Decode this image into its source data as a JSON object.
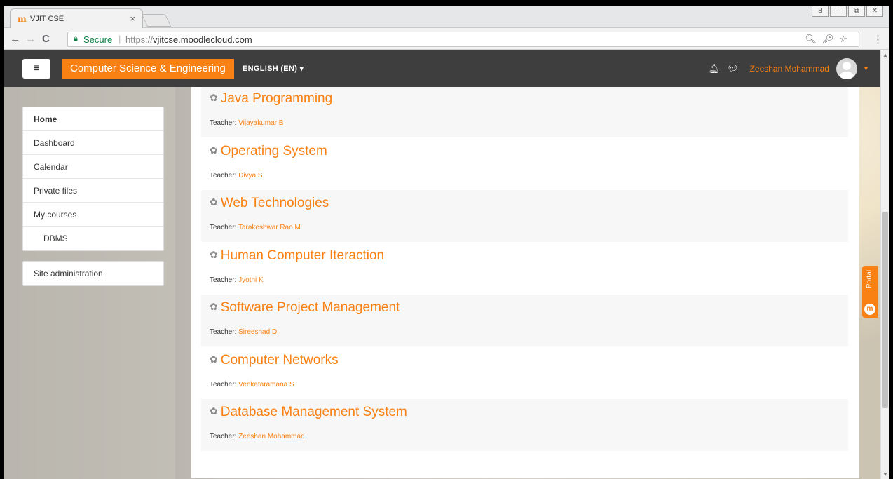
{
  "browser": {
    "tab_title": "VJIT CSE",
    "tab_close": "×",
    "favicon": "m",
    "secure_label": "Secure",
    "url_proto": "https://",
    "url_host": "vjitcse.moodlecloud.com",
    "back": "←",
    "forward": "→",
    "reload": "C",
    "right_icons": "🔍︎🔑︎☆",
    "menu": "⋮",
    "win_controls": [
      "8",
      "–",
      "⧉",
      "✕"
    ]
  },
  "navbar": {
    "menu_icon": "≡",
    "site_name": "Computer Science & Engineering",
    "language": "ENGLISH (EN) ▾",
    "bell": "🔔︎",
    "chat": "💬︎",
    "user_name": "Zeeshan Mohammad",
    "caret": "▾"
  },
  "drawer": {
    "main_items": [
      {
        "label": "Home"
      },
      {
        "label": "Dashboard"
      },
      {
        "label": "Calendar"
      },
      {
        "label": "Private files"
      },
      {
        "label": "My courses"
      },
      {
        "label": "DBMS"
      }
    ],
    "admin_items": [
      {
        "label": "Site administration"
      }
    ]
  },
  "courses": {
    "teacher_prefix": "Teacher: ",
    "list": [
      {
        "title": "Java Programming",
        "teacher": "Vijayakumar B"
      },
      {
        "title": "Operating System",
        "teacher": "Divya S"
      },
      {
        "title": "Web Technologies",
        "teacher": "Tarakeshwar Rao M"
      },
      {
        "title": "Human Computer Iteraction",
        "teacher": "Jyothi K"
      },
      {
        "title": "Software Project Management",
        "teacher": "Sireeshad D"
      },
      {
        "title": "Computer Networks",
        "teacher": "Venkataramana S"
      },
      {
        "title": "Database Management System",
        "teacher": "Zeeshan Mohammad"
      }
    ]
  },
  "portal": {
    "label": "Portal",
    "icon": "m"
  },
  "colors": {
    "accent": "#f98012",
    "navbar": "#3e3e3e"
  }
}
